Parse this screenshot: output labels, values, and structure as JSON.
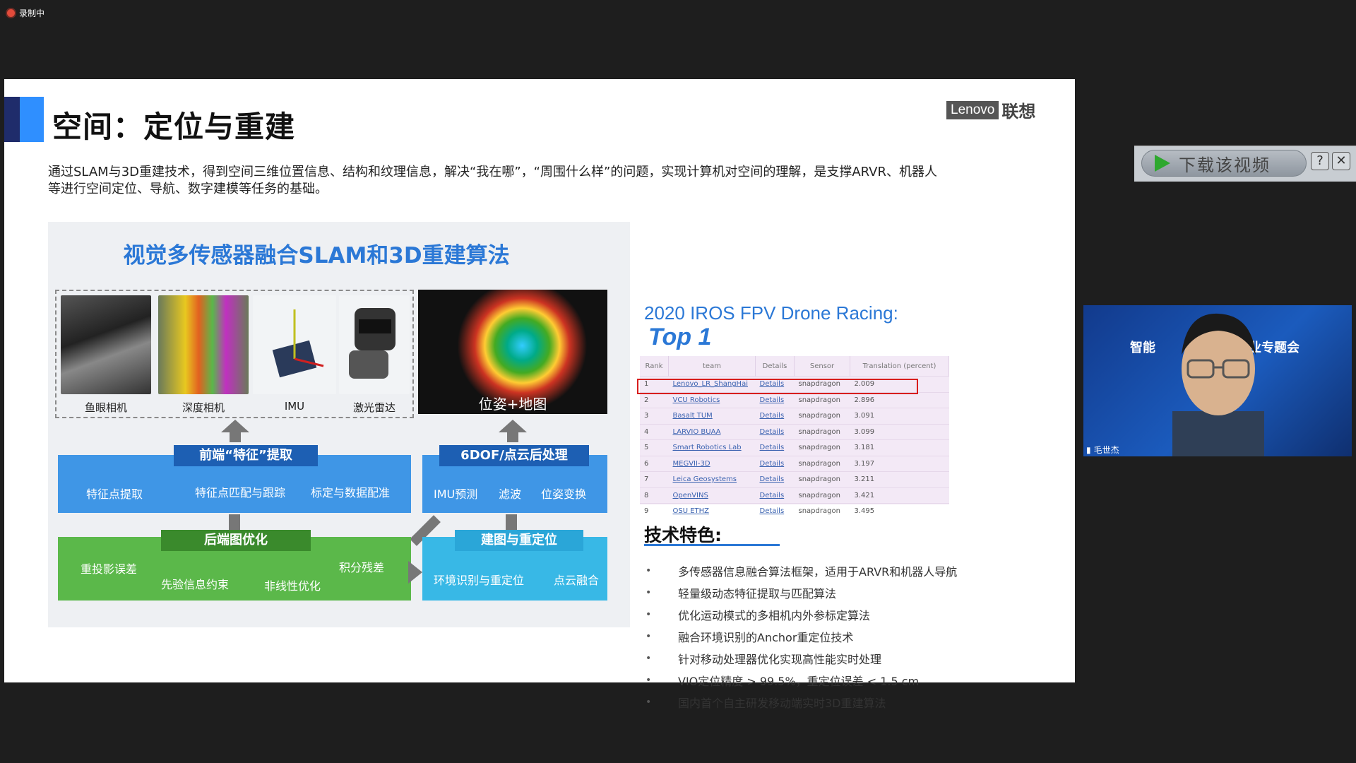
{
  "recording": {
    "label": "录制中"
  },
  "slide": {
    "title": "空间：定位与重建",
    "logo_en": "Lenovo",
    "logo_cn": "联想",
    "intro_1": "通过SLAM与3D重建技术，得到空间三维位置信息、结构和纹理信息，解决“我在哪”，“周围什么样”的问题，实现计算机对空间的理解，是支撑ARVR、机器人",
    "intro_2": "等进行空间定位、导航、数字建模等任务的基础。"
  },
  "diagram": {
    "title": "视觉多传感器融合SLAM和3D重建算法",
    "sensors": [
      "鱼眼相机",
      "深度相机",
      "IMU",
      "激光雷达"
    ],
    "pose_label": "位姿+地图",
    "frontend": {
      "tag": "前端“特征”提取",
      "items": [
        "特征点提取",
        "特征点匹配与跟踪",
        "标定与数据配准"
      ]
    },
    "postproc": {
      "tag": "6DOF/点云后处理",
      "items": [
        "IMU预测",
        "滤波",
        "位姿变换"
      ]
    },
    "backend": {
      "tag": "后端图优化",
      "items": [
        "重投影误差",
        "先验信息约束",
        "非线性优化",
        "积分残差"
      ]
    },
    "reloc": {
      "tag": "建图与重定位",
      "items": [
        "环境识别与重定位",
        "点云融合"
      ]
    }
  },
  "race": {
    "title": "2020 IROS FPV Drone Racing:",
    "top": "Top 1",
    "headers": [
      "Rank",
      "team",
      "Details",
      "Sensor",
      "Translation (percent)"
    ],
    "rows": [
      [
        "1",
        "Lenovo_LR_ShangHai",
        "Details",
        "snapdragon",
        "2.009"
      ],
      [
        "2",
        "VCU Robotics",
        "Details",
        "snapdragon",
        "2.896"
      ],
      [
        "3",
        "Basalt TUM",
        "Details",
        "snapdragon",
        "3.091"
      ],
      [
        "4",
        "LARVIO BUAA",
        "Details",
        "snapdragon",
        "3.099"
      ],
      [
        "5",
        "Smart Robotics Lab",
        "Details",
        "snapdragon",
        "3.181"
      ],
      [
        "6",
        "MEGVII-3D",
        "Details",
        "snapdragon",
        "3.197"
      ],
      [
        "7",
        "Leica Geosystems",
        "Details",
        "snapdragon",
        "3.211"
      ],
      [
        "8",
        "OpenVINS",
        "Details",
        "snapdragon",
        "3.421"
      ],
      [
        "9",
        "OSU ETHZ",
        "Details",
        "snapdragon",
        "3.495"
      ]
    ]
  },
  "features": {
    "title": "技术特色:",
    "items": [
      "多传感器信息融合算法框架，适用于ARVR和机器人导航",
      "轻量级动态特征提取与匹配算法",
      "优化运动模式的多相机内外参标定算法",
      "融合环境识别的Anchor重定位技术",
      "针对移动处理器优化实现高性能实时处理",
      "VIO定位精度 > 99.5%，重定位误差 < 1.5 cm",
      "国内首个自主研发移动端实时3D重建算法"
    ]
  },
  "download": {
    "label": "下载该视频",
    "help": "?",
    "close": "✕"
  },
  "webcam": {
    "name": "毛世杰",
    "bg_text_1": "智能",
    "bg_text_2": "业专题会"
  },
  "colors": {
    "accent_blue": "#2b78d6",
    "highlight_red": "#d81e1e"
  }
}
